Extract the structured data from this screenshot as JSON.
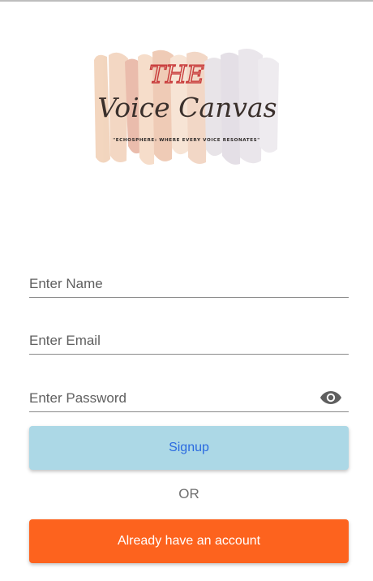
{
  "logo": {
    "line1": "THE",
    "line2": "Voice Canvas",
    "tagline": "\"ECHOSPHERE: WHERE EVERY VOICE RESONATES\""
  },
  "form": {
    "name_placeholder": "Enter Name",
    "email_placeholder": "Enter Email",
    "password_placeholder": "Enter Password",
    "password_toggle_icon": "eye-icon"
  },
  "actions": {
    "signup_label": "Signup",
    "or_label": "OR",
    "login_label": "Already have an account"
  },
  "colors": {
    "signup_bg": "#acd8e6",
    "signup_text": "#2a6ae0",
    "login_bg": "#fd631e",
    "login_text": "#ffffff"
  }
}
